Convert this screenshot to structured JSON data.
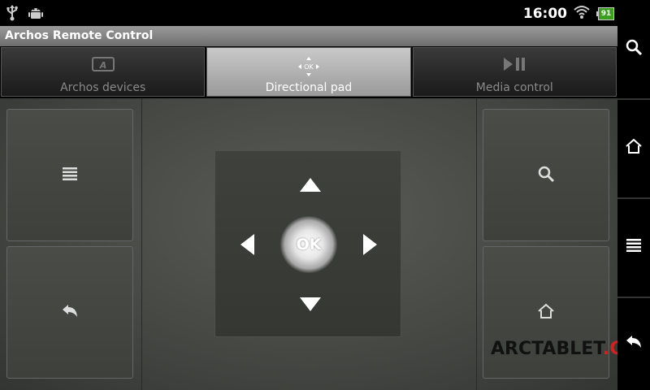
{
  "status_bar": {
    "icons": [
      "usb-icon",
      "android-debug-icon",
      "wifi-icon",
      "battery-icon"
    ],
    "time": "16:00",
    "battery_level": "91"
  },
  "app": {
    "title": "Archos Remote Control"
  },
  "tabs": [
    {
      "label": "Archos devices",
      "icon": "archos-device-icon",
      "active": false
    },
    {
      "label": "Directional pad",
      "icon": "dpad-icon",
      "icon_text": "OK",
      "active": true
    },
    {
      "label": "Media control",
      "icon": "play-pause-icon",
      "active": false
    }
  ],
  "left_buttons": [
    {
      "name": "menu-button",
      "icon": "menu-icon"
    },
    {
      "name": "back-button",
      "icon": "back-arrow-icon"
    }
  ],
  "right_buttons": [
    {
      "name": "search-button",
      "icon": "search-icon"
    },
    {
      "name": "home-button",
      "icon": "home-icon"
    }
  ],
  "dpad": {
    "ok_label": "OK",
    "arrows": [
      "up",
      "down",
      "left",
      "right"
    ]
  },
  "system_bar": {
    "buttons": [
      "search-icon",
      "home-icon",
      "menu-icon",
      "back-icon"
    ]
  },
  "watermark": {
    "part_a": "ARCTABLET",
    "part_b": ".COM"
  },
  "colors": {
    "battery": "#3c9e1e",
    "watermark_accent": "#d42020",
    "tab_active": "#b5b5b5"
  }
}
